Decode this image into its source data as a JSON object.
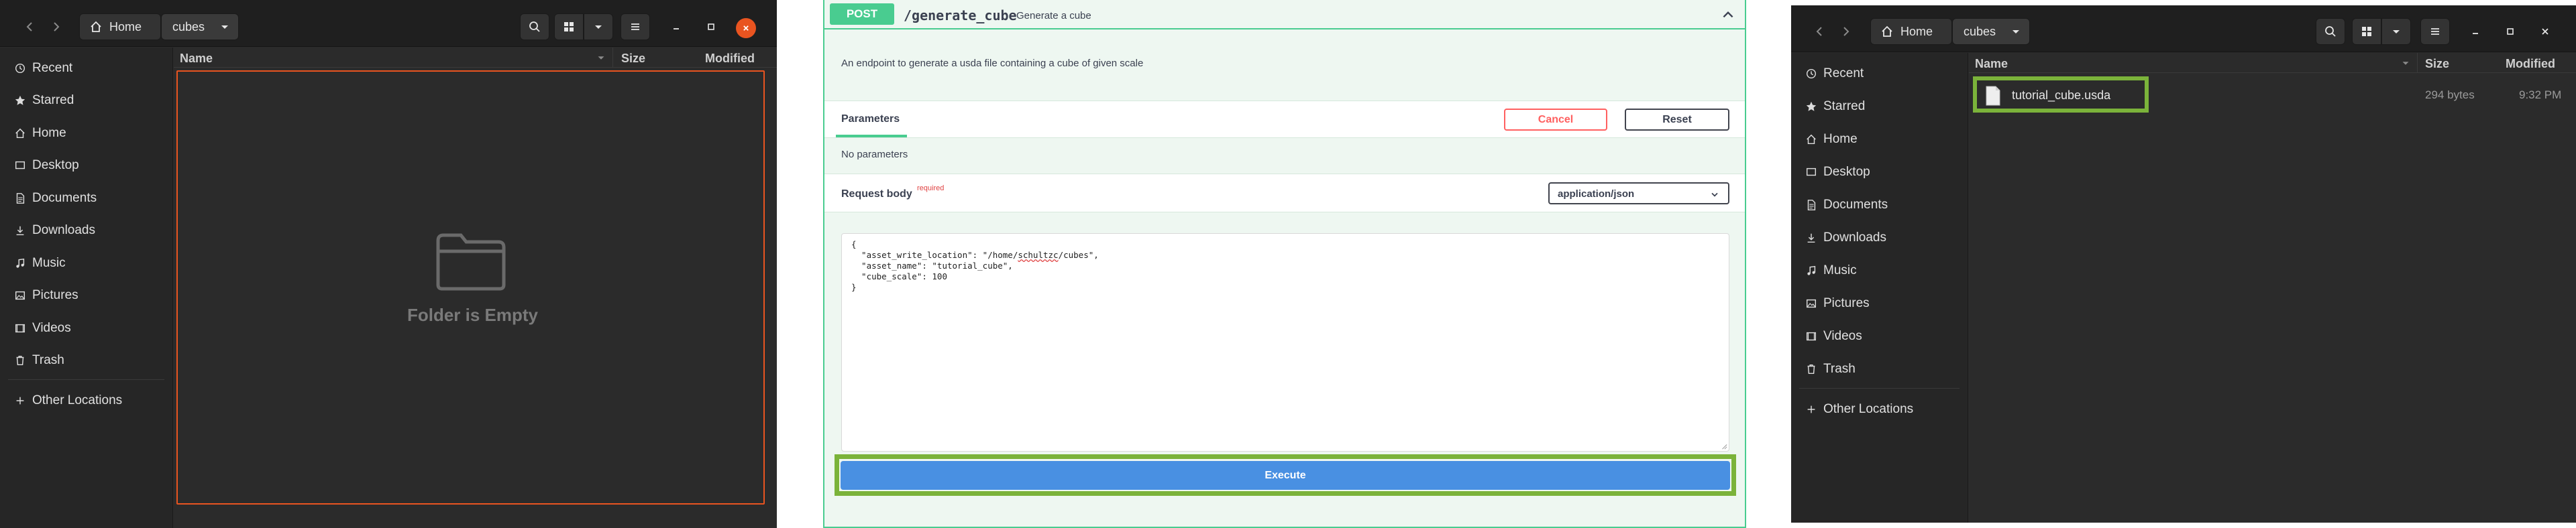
{
  "left_window": {
    "breadcrumb": {
      "home": "Home",
      "current": "cubes"
    },
    "sidebar": [
      {
        "label": "Recent",
        "icon": "clock-icon"
      },
      {
        "label": "Starred",
        "icon": "star-icon"
      },
      {
        "label": "Home",
        "icon": "home-icon"
      },
      {
        "label": "Desktop",
        "icon": "desktop-icon"
      },
      {
        "label": "Documents",
        "icon": "document-icon"
      },
      {
        "label": "Downloads",
        "icon": "download-icon"
      },
      {
        "label": "Music",
        "icon": "music-icon"
      },
      {
        "label": "Pictures",
        "icon": "picture-icon"
      },
      {
        "label": "Videos",
        "icon": "video-icon"
      },
      {
        "label": "Trash",
        "icon": "trash-icon"
      },
      {
        "label": "Other Locations",
        "icon": "plus-icon"
      }
    ],
    "columns": {
      "name": "Name",
      "size": "Size",
      "modified": "Modified"
    },
    "empty_message": "Folder is Empty",
    "empty_icon": "folder-icon",
    "accent_color": "#e95420"
  },
  "swagger": {
    "method": "POST",
    "path": "/generate_cube",
    "summary": "Generate a cube",
    "description": "An endpoint to generate a usda file containing a cube of given scale",
    "parameters_tab": "Parameters",
    "cancel_label": "Cancel",
    "reset_label": "Reset",
    "no_params": "No parameters",
    "request_body_label": "Request body",
    "required_label": "required",
    "content_type": "application/json",
    "body": {
      "line1": "{",
      "line2_pre": "  \"asset_write_location\": \"/home/",
      "line2_user": "schultzc",
      "line2_post": "/cubes\",",
      "line3": "  \"asset_name\": \"tutorial_cube\",",
      "line4": "  \"cube_scale\": 100",
      "line5": "}"
    },
    "execute_label": "Execute",
    "post_color": "#49cc90",
    "execute_color": "#4990e2",
    "highlight_color": "#7bb33a"
  },
  "right_window": {
    "breadcrumb": {
      "home": "Home",
      "current": "cubes"
    },
    "sidebar": [
      {
        "label": "Recent",
        "icon": "clock-icon"
      },
      {
        "label": "Starred",
        "icon": "star-icon"
      },
      {
        "label": "Home",
        "icon": "home-icon"
      },
      {
        "label": "Desktop",
        "icon": "desktop-icon"
      },
      {
        "label": "Documents",
        "icon": "document-icon"
      },
      {
        "label": "Downloads",
        "icon": "download-icon"
      },
      {
        "label": "Music",
        "icon": "music-icon"
      },
      {
        "label": "Pictures",
        "icon": "picture-icon"
      },
      {
        "label": "Videos",
        "icon": "video-icon"
      },
      {
        "label": "Trash",
        "icon": "trash-icon"
      },
      {
        "label": "Other Locations",
        "icon": "plus-icon"
      }
    ],
    "columns": {
      "name": "Name",
      "size": "Size",
      "modified": "Modified"
    },
    "files": [
      {
        "name": "tutorial_cube.usda",
        "size": "294 bytes",
        "modified": "9:32 PM",
        "icon": "file-icon"
      }
    ]
  }
}
